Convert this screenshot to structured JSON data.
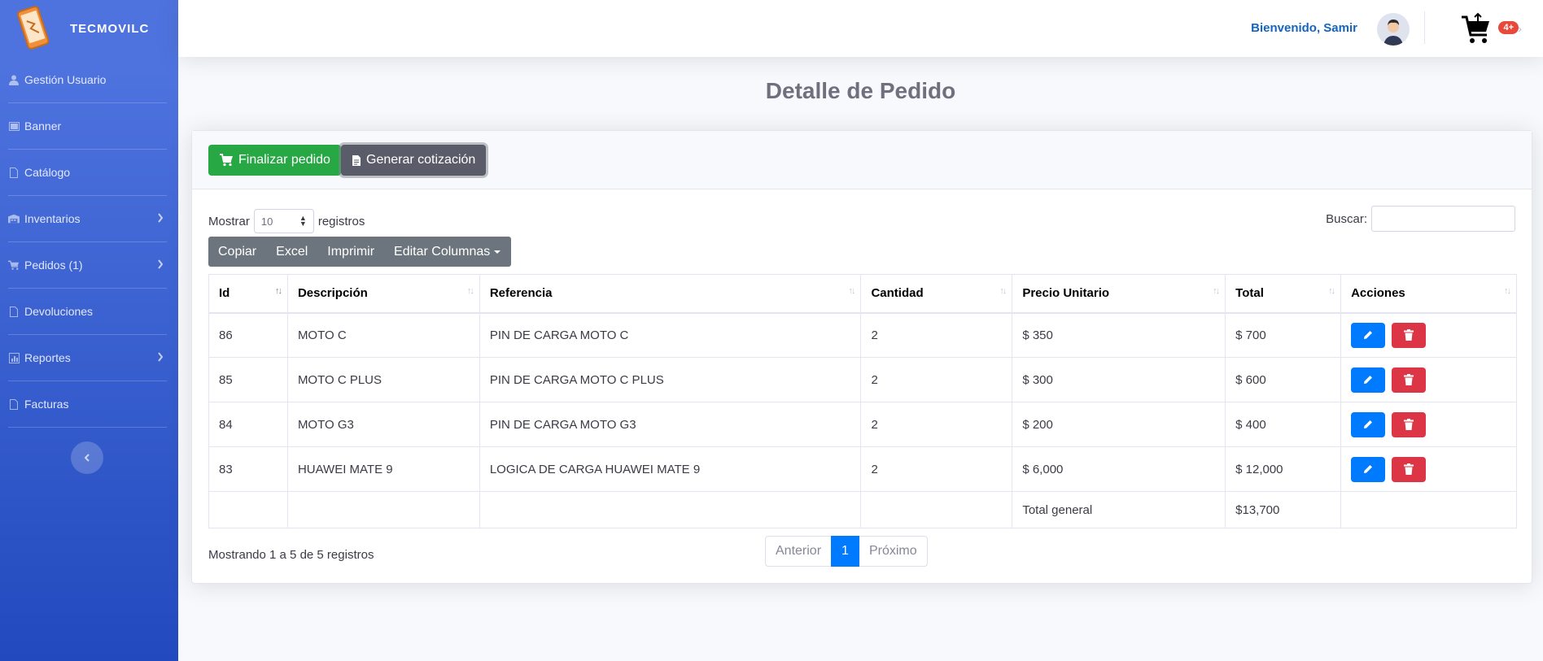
{
  "brand": {
    "name": "TECMOVILC"
  },
  "sidebar": {
    "items": [
      {
        "label": "Gestión Usuario",
        "icon": "user-icon",
        "has_submenu": false
      },
      {
        "label": "Banner",
        "icon": "image-icon",
        "has_submenu": false
      },
      {
        "label": "Catálogo",
        "icon": "file-icon",
        "has_submenu": false
      },
      {
        "label": "Inventarios",
        "icon": "warehouse-icon",
        "has_submenu": true
      },
      {
        "label": "Pedidos (1)",
        "icon": "cart-icon",
        "has_submenu": true
      },
      {
        "label": "Devoluciones",
        "icon": "file-icon",
        "has_submenu": false
      },
      {
        "label": "Reportes",
        "icon": "report-icon",
        "has_submenu": true
      },
      {
        "label": "Facturas",
        "icon": "file-icon",
        "has_submenu": false
      }
    ]
  },
  "topbar": {
    "welcome": "Bienvenido, Samir",
    "cart_badge": "4+"
  },
  "page": {
    "title": "Detalle de Pedido"
  },
  "actions": {
    "finish": "Finalizar pedido",
    "quote": "Generar cotización"
  },
  "datatable": {
    "length_prefix": "Mostrar",
    "length_value": "10",
    "length_suffix": "registros",
    "search_label": "Buscar:",
    "buttons": [
      "Copiar",
      "Excel",
      "Imprimir",
      "Editar Columnas"
    ],
    "columns": [
      "Id",
      "Descripción",
      "Referencia",
      "Cantidad",
      "Precio Unitario",
      "Total",
      "Acciones"
    ],
    "rows": [
      {
        "id": "86",
        "descripcion": "MOTO C",
        "referencia": "PIN DE CARGA MOTO C",
        "cantidad": "2",
        "precio": "$ 350",
        "total": "$ 700"
      },
      {
        "id": "85",
        "descripcion": "MOTO C PLUS",
        "referencia": "PIN DE CARGA MOTO C PLUS",
        "cantidad": "2",
        "precio": "$ 300",
        "total": "$ 600"
      },
      {
        "id": "84",
        "descripcion": "MOTO G3",
        "referencia": "PIN DE CARGA MOTO G3",
        "cantidad": "2",
        "precio": "$ 200",
        "total": "$ 400"
      },
      {
        "id": "83",
        "descripcion": "HUAWEI MATE 9",
        "referencia": "LOGICA DE CARGA HUAWEI MATE 9",
        "cantidad": "2",
        "precio": "$ 6,000",
        "total": "$ 12,000"
      }
    ],
    "footer": {
      "label": "Total general",
      "value": "$13,700"
    },
    "info": "Mostrando 1 a 5 de 5 registros",
    "pagination": {
      "prev": "Anterior",
      "current": "1",
      "next": "Próximo"
    }
  },
  "colors": {
    "sidebar_top": "#4e73df",
    "sidebar_bottom": "#224abe",
    "success": "#28a745",
    "primary": "#007bff",
    "danger": "#dc3545",
    "secondary": "#6c757d"
  }
}
